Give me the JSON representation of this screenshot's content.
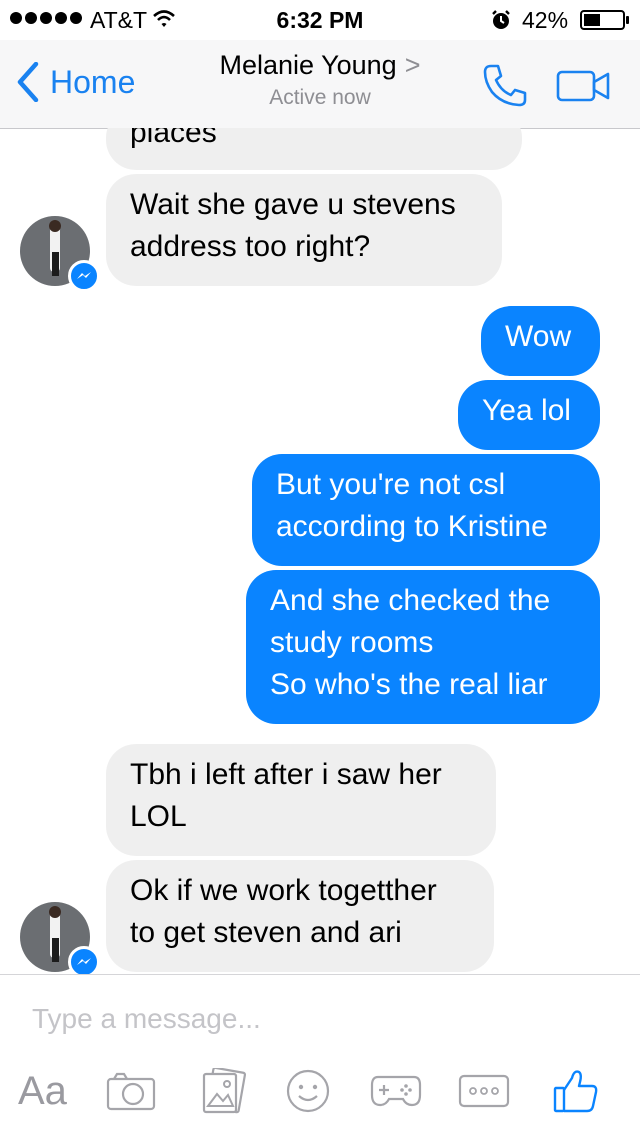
{
  "status_bar": {
    "carrier": "AT&T",
    "time": "6:32 PM",
    "battery_percent": "42%",
    "battery_level": 0.42,
    "signal_bars": 5
  },
  "header": {
    "back_label": "Home",
    "contact_name": "Melanie Young",
    "chevron": ">",
    "presence": "Active now"
  },
  "messages": [
    {
      "from": "them",
      "lines": [
        "places"
      ]
    },
    {
      "from": "them",
      "lines": [
        "Wait she gave u stevens",
        "address too right?"
      ]
    },
    {
      "from": "me",
      "lines": [
        "Wow"
      ]
    },
    {
      "from": "me",
      "lines": [
        "Yea lol"
      ]
    },
    {
      "from": "me",
      "lines": [
        "But you're not csl",
        "according to Kristine"
      ]
    },
    {
      "from": "me",
      "lines": [
        "And she checked the",
        "study rooms",
        "So who's the real liar"
      ]
    },
    {
      "from": "them",
      "lines": [
        "Tbh i left after i saw her",
        "LOL"
      ]
    },
    {
      "from": "them",
      "lines": [
        "Ok if we work togetther",
        "to get steven and ari"
      ]
    }
  ],
  "composer": {
    "placeholder": "Type a message...",
    "value": "",
    "text_format_label": "Aa",
    "icons": [
      "camera-icon",
      "photo-icon",
      "emoji-icon",
      "game-icon",
      "more-icon",
      "like-icon"
    ]
  },
  "colors": {
    "accent": "#0a84ff",
    "incoming_bubble": "#efefef",
    "nav_background": "#f7f7f8",
    "secondary_text": "#8e8e93"
  }
}
